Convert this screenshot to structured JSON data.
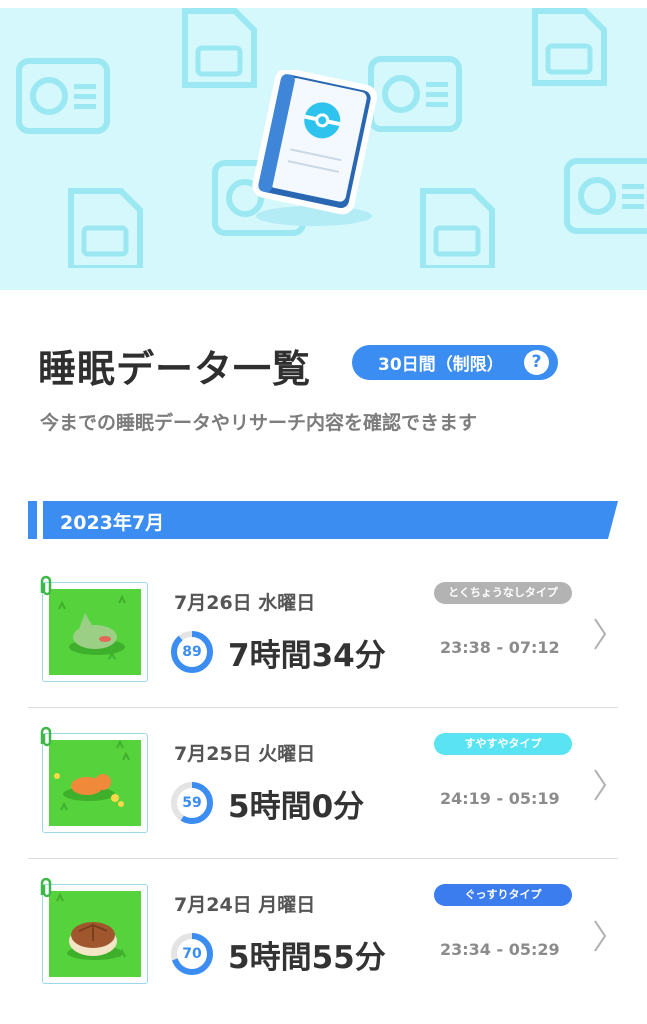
{
  "header": {
    "title": "睡眠データ一覧",
    "period_label": "30日間（制限）",
    "help_label": "?",
    "subtitle": "今までの睡眠データやリサーチ内容を確認できます"
  },
  "month_label": "2023年7月",
  "colors": {
    "accent_blue": "#3b8df2",
    "hero_bg": "#d4f8fc",
    "type_gray": "#b3b3b3",
    "type_cyan": "#5ae3f2",
    "type_blue": "#3b7cef"
  },
  "entries": [
    {
      "date": "7月26日 水曜日",
      "score": "89",
      "score_value": 89,
      "duration": "7時間34分",
      "sleep_type": "とくちょうなしタイプ",
      "time_range": "23:38 - 07:12",
      "pokemon_icon": "larvitar-sleeping-icon"
    },
    {
      "date": "7月25日 火曜日",
      "score": "59",
      "score_value": 59,
      "duration": "5時間0分",
      "sleep_type": "すやすやタイプ",
      "time_range": "24:19 - 05:19",
      "pokemon_icon": "charmander-sleeping-icon"
    },
    {
      "date": "7月24日 月曜日",
      "score": "70",
      "score_value": 70,
      "duration": "5時間55分",
      "sleep_type": "ぐっすりタイプ",
      "time_range": "23:34 - 05:29",
      "pokemon_icon": "squirtle-shell-icon"
    }
  ]
}
